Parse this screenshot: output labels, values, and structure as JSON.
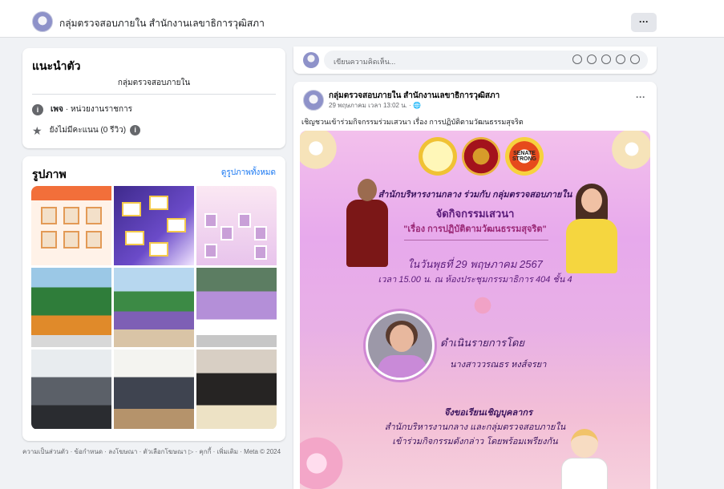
{
  "header": {
    "page_name": "กลุ่มตรวจสอบภายใน สำนักงานเลขาธิการวุฒิสภา",
    "more_label": "···"
  },
  "intro": {
    "title": "แนะนำตัว",
    "bio": "กลุ่มตรวจสอบภายใน",
    "page_type_bold": "เพจ",
    "page_type_rest": "· หน่วยงานราชการ",
    "rating": "ยังไม่มีคะแนน (0 รีวิว)"
  },
  "photos": {
    "title": "รูปภาพ",
    "see_all": "ดูรูปภาพทั้งหมด"
  },
  "footer": {
    "text": "ความเป็นส่วนตัว · ข้อกำหนด · ลงโฆษณา · ตัวเลือกโฆษณา ▷ · คุกกี้ · เพิ่มเติม · Meta © 2024"
  },
  "comment_box": {
    "placeholder": "เขียนความคิดเห็น..."
  },
  "post": {
    "author": "กลุ่มตรวจสอบภายใน สำนักงานเลขาธิการวุฒิสภา",
    "timestamp": "29 พฤษภาคม เวลา 13:02 น. · 🌐",
    "caption": "เชิญชวนเข้าร่วมกิจกรรมร่วมเสวนา เรื่อง การปฏิบัติตามวัฒนธรรมสุจริต",
    "more_label": "···"
  },
  "poster": {
    "logo3_text": "SENATE STRONG",
    "line1": "สำนักบริหารงานกลาง ร่วมกับ กลุ่มตรวจสอบภายใน",
    "line2": "จัดกิจกรรมเสวนา",
    "line3": "\"เรื่อง การปฏิบัติตามวัฒนธรรมสุจริต\"",
    "date": "ในวันพุธที่ 29 พฤษภาคม 2567",
    "time_place": "เวลา 15.00 น. ณ ห้องประชุมกรรมาธิการ 404 ชั้น 4",
    "host_label": "ดำเนินรายการโดย",
    "host_name": "นางสาววรณธร หงส์จรยา",
    "invite1": "จึงขอเรียนเชิญบุคลากร",
    "invite2": "สำนักบริหารงานกลาง และกลุ่มตรวจสอบภายใน",
    "invite3": "เข้าร่วมกิจกรรมดังกล่าว โดยพร้อมเพรียงกัน"
  }
}
